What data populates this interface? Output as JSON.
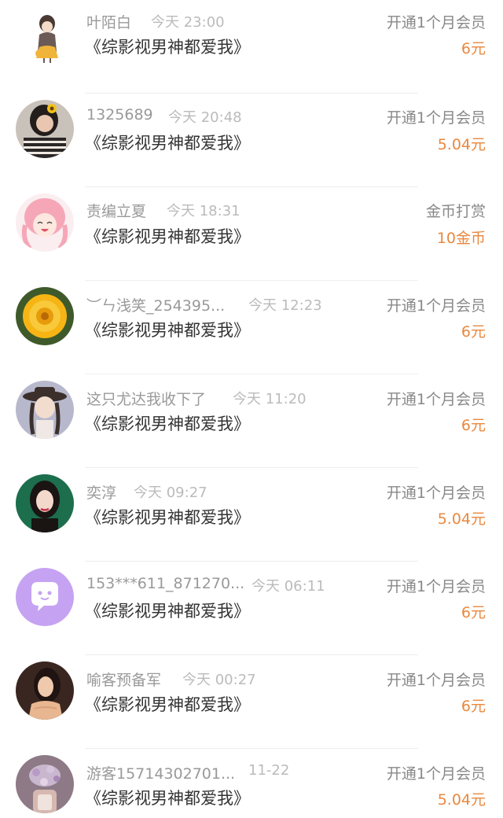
{
  "book_title": "《综影视男神都爱我》",
  "colors": {
    "accent": "#e9883f",
    "muted": "#999999",
    "text": "#333333"
  },
  "records": [
    {
      "name": "叶陌白",
      "time": "今天 23:00",
      "action": "开通1个月会员",
      "amount": "6元",
      "avatar": "girl-illustration-avatar"
    },
    {
      "name": "1325689",
      "time": "今天 20:48",
      "action": "开通1个月会员",
      "amount": "5.04元",
      "avatar": "girl-sunflower-avatar"
    },
    {
      "name": "责编立夏",
      "time": "今天 18:31",
      "action": "金币打赏",
      "amount": "10金币",
      "avatar": "anime-pink-hair-avatar"
    },
    {
      "name": "︶ㄣ浅笑_254395...",
      "time": "今天 12:23",
      "action": "开通1个月会员",
      "amount": "6元",
      "avatar": "yellow-flower-avatar"
    },
    {
      "name": "这只尤达我收下了",
      "time": "今天 11:20",
      "action": "开通1个月会员",
      "amount": "6元",
      "avatar": "girl-hat-avatar"
    },
    {
      "name": "奕淳",
      "time": "今天 09:27",
      "action": "开通1个月会员",
      "amount": "5.04元",
      "avatar": "woman-green-bg-avatar"
    },
    {
      "name": "153***611_871270...",
      "time": "今天 06:11",
      "action": "开通1个月会员",
      "amount": "6元",
      "avatar": "chat-bubble-default-avatar"
    },
    {
      "name": "喻客预备军",
      "time": "今天 00:27",
      "action": "开通1个月会员",
      "amount": "6元",
      "avatar": "woman-warm-tone-avatar"
    },
    {
      "name": "游客15714302701...",
      "time": "11-22",
      "action": "开通1个月会员",
      "amount": "5.04元",
      "avatar": "lavender-flowers-avatar"
    }
  ]
}
